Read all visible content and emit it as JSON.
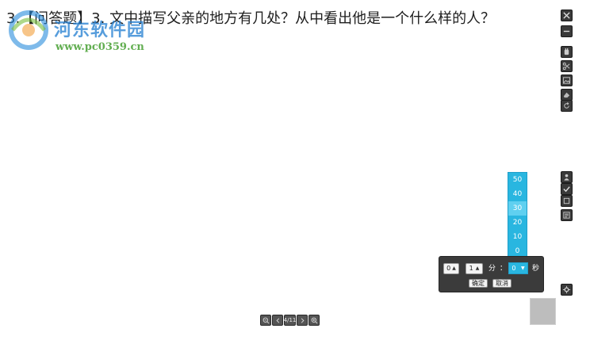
{
  "question": {
    "text": "3.【问答题】3. 文中描写父亲的地方有几处？从中看出他是一个什么样的人？"
  },
  "watermark": {
    "title": "河东软件园",
    "url": "www.pc0359.cn"
  },
  "toolbar": {
    "icons": [
      "close-icon",
      "minimize-icon",
      "hand-icon",
      "scissors-icon",
      "image-icon",
      "eraser-icon",
      "rotate-icon",
      "person-icon",
      "check-icon",
      "box-icon",
      "note-icon",
      "settings-icon"
    ]
  },
  "timer": {
    "hours_value": "0",
    "minutes_value": "1",
    "minutes_unit": "分",
    "colon": "：",
    "seconds_value": "0",
    "seconds_unit": "秒",
    "confirm_label": "确定",
    "cancel_label": "取消",
    "seconds_options": [
      "50",
      "40",
      "30",
      "20",
      "10",
      "0"
    ],
    "highlighted_option": "30"
  },
  "pager": {
    "page_label": "4/11"
  },
  "colors": {
    "accent": "#29b6e0",
    "panel": "#3b3b3b",
    "toolbar": "#3a3a3a"
  }
}
